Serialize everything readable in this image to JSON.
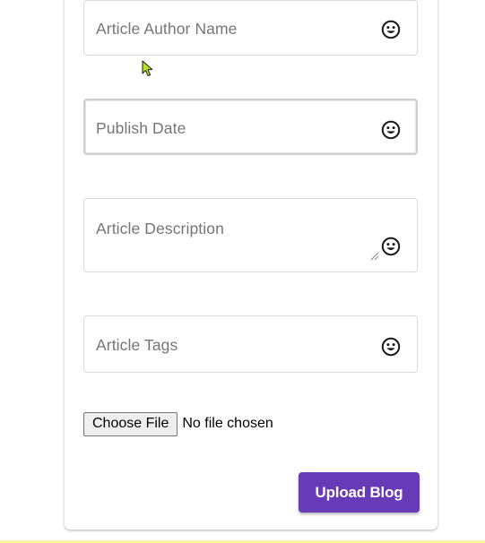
{
  "form": {
    "author_placeholder": "Article Author Name",
    "date_placeholder": "Publish Date",
    "description_placeholder": "Article Description",
    "tags_placeholder": "Article Tags"
  },
  "file_input": {
    "button_label": "Choose File",
    "status": "No file chosen"
  },
  "actions": {
    "upload_label": "Upload Blog"
  },
  "icons": {
    "field_icon": "smiley-face-icon",
    "cursor": "mouse-pointer-icon"
  },
  "colors": {
    "primary_button": "#673ab7",
    "placeholder_text": "#757575",
    "cursor": "#b5e61d"
  }
}
